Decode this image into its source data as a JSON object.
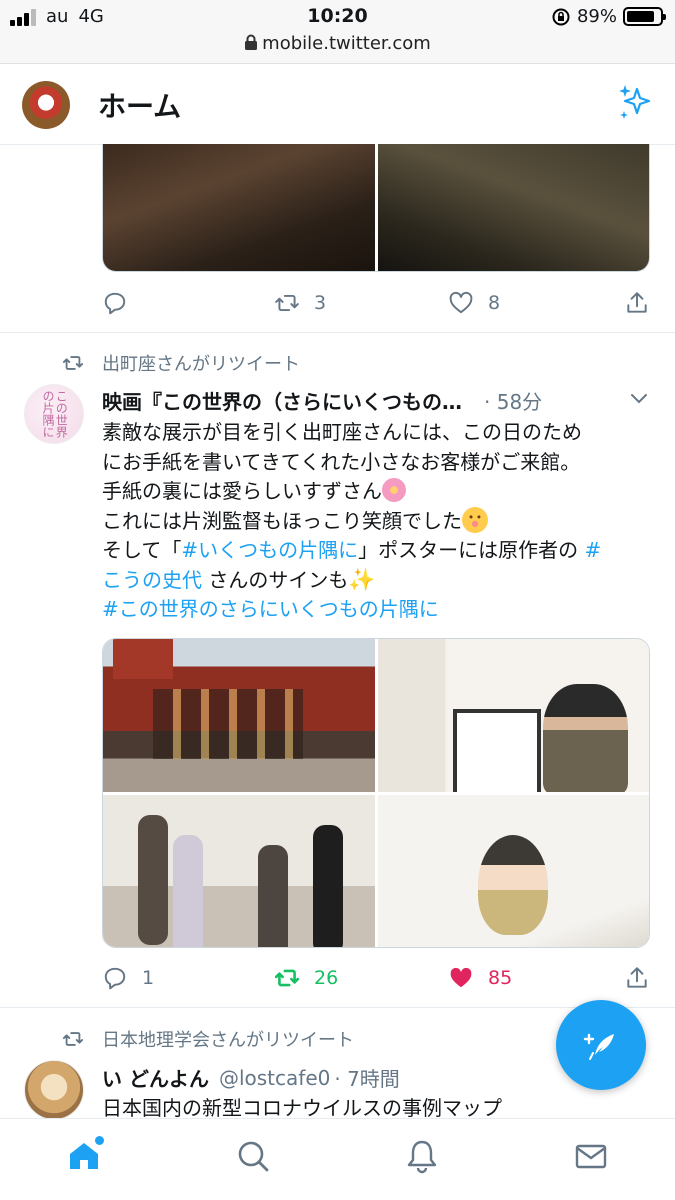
{
  "status_bar": {
    "carrier": "au",
    "network": "4G",
    "time": "10:20",
    "url": "mobile.twitter.com",
    "battery": "89%"
  },
  "header": {
    "title": "ホーム"
  },
  "tweet1": {
    "reply_count": "",
    "retweet_count": "3",
    "like_count": "8"
  },
  "tweet2": {
    "retweet_label": "出町座さんがリツイート",
    "name": "映画『この世界の（さらにいくつもの…",
    "time": "· 58分",
    "avatar_text": "この世界の片隅に",
    "text": {
      "line1": "素敵な展示が目を引く出町座さんには、この日のため",
      "line2": "にお手紙を書いてきてくれた小さなお客様がご来館。",
      "line3": "手紙の裏には愛らしいすずさん",
      "line4": "これには片渕監督もほっこり笑顔でした",
      "line5_a": "そして「",
      "line5_tag": "#いくつもの片隅に",
      "line5_b": "」ポスターには原作者の ",
      "line5_tag2": "#",
      "line6_tag": "こうの史代",
      "line6_b": " さんのサインも",
      "line7_tag": "#この世界のさらにいくつもの片隅に"
    },
    "reply_count": "1",
    "retweet_count": "26",
    "like_count": "85",
    "colors": {
      "retweeted": "#17bf63",
      "liked": "#e0245e"
    }
  },
  "tweet3": {
    "retweet_label": "日本地理学会さんがリツイート",
    "name": "い どんよん",
    "handle": "@lostcafe0",
    "time": "· 7時間",
    "text": "日本国内の新型コロナウイルスの事例マップ"
  },
  "nav": {
    "items": [
      "home-icon",
      "search-icon",
      "notifications-icon",
      "messages-icon"
    ]
  },
  "colors": {
    "accent": "#1da1f2",
    "muted": "#657786"
  }
}
